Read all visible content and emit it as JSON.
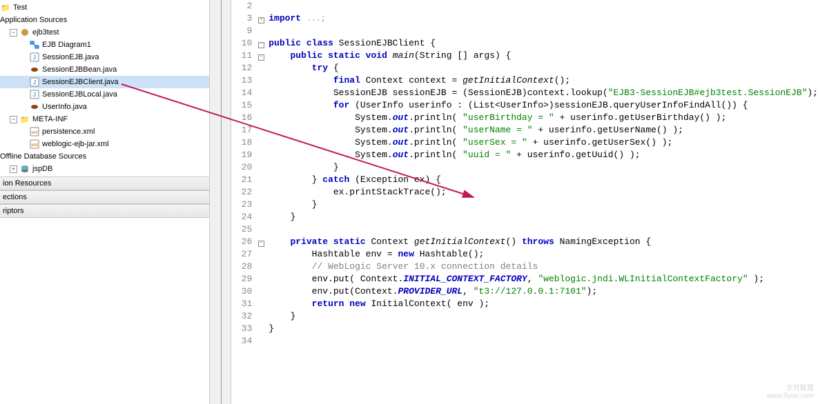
{
  "left": {
    "root": "Test",
    "sections": [
      "Application Sources",
      "Offline Database Sources",
      "ion Resources",
      "ections",
      "riptors"
    ],
    "pkg": "ejb3test",
    "items": [
      {
        "icon": "ejb-diagram",
        "label": "EJB Diagram1",
        "indent": 2
      },
      {
        "icon": "java",
        "label": "SessionEJB.java",
        "indent": 2
      },
      {
        "icon": "bean",
        "label": "SessionEJBBean.java",
        "indent": 2
      },
      {
        "icon": "java",
        "label": "SessionEJBClient.java",
        "indent": 2,
        "selected": true
      },
      {
        "icon": "java",
        "label": "SessionEJBLocal.java",
        "indent": 2
      },
      {
        "icon": "bean",
        "label": "UserInfo.java",
        "indent": 2
      }
    ],
    "meta": "META-INF",
    "meta_items": [
      {
        "icon": "xml",
        "label": "persistence.xml",
        "indent": 2
      },
      {
        "icon": "xml",
        "label": "weblogic-ejb-jar.xml",
        "indent": 2
      }
    ],
    "jspdb": "jspDB"
  },
  "code": {
    "lines": [
      {
        "n": 2,
        "fold": "",
        "frag": []
      },
      {
        "n": 3,
        "fold": "+",
        "frag": [
          {
            "t": "import ",
            "c": "kw"
          },
          {
            "t": "...;",
            "c": "dotted-fold"
          }
        ]
      },
      {
        "n": 9,
        "fold": "",
        "frag": []
      },
      {
        "n": 10,
        "fold": "-",
        "frag": [
          {
            "t": "public class ",
            "c": "kw"
          },
          {
            "t": "SessionEJBClient {",
            "c": ""
          }
        ]
      },
      {
        "n": 11,
        "fold": "-",
        "frag": [
          {
            "t": "    ",
            "c": ""
          },
          {
            "t": "public static void ",
            "c": "kw"
          },
          {
            "t": "main",
            "c": "mth"
          },
          {
            "t": "(String [] args) {",
            "c": ""
          }
        ]
      },
      {
        "n": 12,
        "fold": "",
        "frag": [
          {
            "t": "        ",
            "c": ""
          },
          {
            "t": "try",
            "c": "kw"
          },
          {
            "t": " {",
            "c": ""
          }
        ]
      },
      {
        "n": 13,
        "fold": "",
        "frag": [
          {
            "t": "            ",
            "c": ""
          },
          {
            "t": "final ",
            "c": "kw"
          },
          {
            "t": "Context context = ",
            "c": ""
          },
          {
            "t": "getInitialContext",
            "c": "mth"
          },
          {
            "t": "();",
            "c": ""
          }
        ]
      },
      {
        "n": 14,
        "fold": "",
        "frag": [
          {
            "t": "            SessionEJB sessionEJB = (SessionEJB)context.lookup(",
            "c": ""
          },
          {
            "t": "\"EJB3-SessionEJB#ejb3test.SessionEJB\"",
            "c": "str"
          },
          {
            "t": ");",
            "c": ""
          }
        ]
      },
      {
        "n": 15,
        "fold": "",
        "frag": [
          {
            "t": "            ",
            "c": ""
          },
          {
            "t": "for",
            "c": "kw"
          },
          {
            "t": " (UserInfo userinfo : (List<UserInfo>)sessionEJB.queryUserInfoFindAll()) {",
            "c": ""
          }
        ]
      },
      {
        "n": 16,
        "fold": "",
        "frag": [
          {
            "t": "                System.",
            "c": ""
          },
          {
            "t": "out",
            "c": "fld"
          },
          {
            "t": ".println( ",
            "c": ""
          },
          {
            "t": "\"userBirthday = \"",
            "c": "str"
          },
          {
            "t": " + userinfo.getUserBirthday() );",
            "c": ""
          }
        ]
      },
      {
        "n": 17,
        "fold": "",
        "frag": [
          {
            "t": "                System.",
            "c": ""
          },
          {
            "t": "out",
            "c": "fld"
          },
          {
            "t": ".println( ",
            "c": ""
          },
          {
            "t": "\"userName = \"",
            "c": "str"
          },
          {
            "t": " + userinfo.getUserName() );",
            "c": ""
          }
        ]
      },
      {
        "n": 18,
        "fold": "",
        "frag": [
          {
            "t": "                System.",
            "c": ""
          },
          {
            "t": "out",
            "c": "fld"
          },
          {
            "t": ".println( ",
            "c": ""
          },
          {
            "t": "\"userSex = \"",
            "c": "str"
          },
          {
            "t": " + userinfo.getUserSex() );",
            "c": ""
          }
        ]
      },
      {
        "n": 19,
        "fold": "",
        "frag": [
          {
            "t": "                System.",
            "c": ""
          },
          {
            "t": "out",
            "c": "fld"
          },
          {
            "t": ".println( ",
            "c": ""
          },
          {
            "t": "\"uuid = \"",
            "c": "str"
          },
          {
            "t": " + userinfo.getUuid() );",
            "c": ""
          }
        ]
      },
      {
        "n": 20,
        "fold": "",
        "frag": [
          {
            "t": "            }",
            "c": ""
          }
        ]
      },
      {
        "n": 21,
        "fold": "",
        "frag": [
          {
            "t": "        } ",
            "c": ""
          },
          {
            "t": "catch",
            "c": "kw"
          },
          {
            "t": " (Exception ex) {",
            "c": ""
          }
        ]
      },
      {
        "n": 22,
        "fold": "",
        "frag": [
          {
            "t": "            ex.printStackTrace();",
            "c": ""
          }
        ]
      },
      {
        "n": 23,
        "fold": "",
        "frag": [
          {
            "t": "        }",
            "c": ""
          }
        ]
      },
      {
        "n": 24,
        "fold": "",
        "frag": [
          {
            "t": "    }",
            "c": ""
          }
        ]
      },
      {
        "n": 25,
        "fold": "",
        "frag": []
      },
      {
        "n": 26,
        "fold": "-",
        "frag": [
          {
            "t": "    ",
            "c": ""
          },
          {
            "t": "private static ",
            "c": "kw"
          },
          {
            "t": "Context ",
            "c": ""
          },
          {
            "t": "getInitialContext",
            "c": "mth"
          },
          {
            "t": "() ",
            "c": ""
          },
          {
            "t": "throws",
            "c": "kw"
          },
          {
            "t": " NamingException {",
            "c": ""
          }
        ]
      },
      {
        "n": 27,
        "fold": "",
        "frag": [
          {
            "t": "        Hashtable env = ",
            "c": ""
          },
          {
            "t": "new",
            "c": "kw"
          },
          {
            "t": " Hashtable();",
            "c": ""
          }
        ]
      },
      {
        "n": 28,
        "fold": "",
        "frag": [
          {
            "t": "        ",
            "c": ""
          },
          {
            "t": "// WebLogic Server 10.x connection details",
            "c": "cmt"
          }
        ]
      },
      {
        "n": 29,
        "fold": "",
        "frag": [
          {
            "t": "        env.put( Context.",
            "c": ""
          },
          {
            "t": "INITIAL_CONTEXT_FACTORY",
            "c": "fld"
          },
          {
            "t": ", ",
            "c": ""
          },
          {
            "t": "\"weblogic.jndi.WLInitialContextFactory\"",
            "c": "str"
          },
          {
            "t": " );",
            "c": ""
          }
        ]
      },
      {
        "n": 30,
        "fold": "",
        "frag": [
          {
            "t": "        env.put(Context.",
            "c": ""
          },
          {
            "t": "PROVIDER_URL",
            "c": "fld"
          },
          {
            "t": ", ",
            "c": ""
          },
          {
            "t": "\"t3://127.0.0.1:7101\"",
            "c": "str"
          },
          {
            "t": ");",
            "c": ""
          }
        ]
      },
      {
        "n": 31,
        "fold": "",
        "frag": [
          {
            "t": "        ",
            "c": ""
          },
          {
            "t": "return new",
            "c": "kw"
          },
          {
            "t": " InitialContext( env );",
            "c": ""
          }
        ]
      },
      {
        "n": 32,
        "fold": "",
        "frag": [
          {
            "t": "    }",
            "c": ""
          }
        ]
      },
      {
        "n": 33,
        "fold": "",
        "frag": [
          {
            "t": "}",
            "c": ""
          }
        ]
      },
      {
        "n": 34,
        "fold": "",
        "frag": []
      }
    ]
  },
  "watermark": {
    "line1": "岁月联盟",
    "line2": "www.Syue.com"
  }
}
